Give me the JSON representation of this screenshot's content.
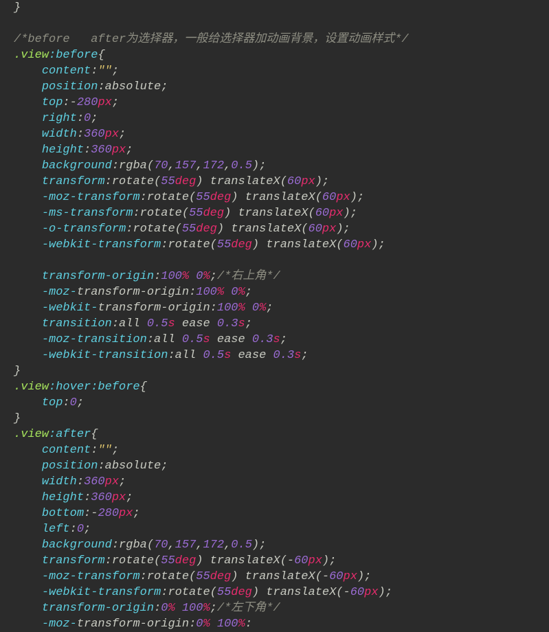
{
  "code": {
    "lines": [
      {
        "t": "punct",
        "s": "}"
      },
      {
        "t": "blank",
        "s": ""
      },
      {
        "t": "comment",
        "s": "/*before   after为选择器，一般给选择器加动画背景，设置动画样式*/"
      },
      {
        "t": "selector",
        "sel": ".view",
        "pseudo": ":before",
        "brace": "{"
      },
      {
        "t": "decl",
        "p": "content",
        "v": [
          {
            "t": "string",
            "s": "\"\""
          }
        ]
      },
      {
        "t": "decl",
        "p": "position",
        "v": [
          {
            "t": "value",
            "s": "absolute"
          }
        ]
      },
      {
        "t": "decl",
        "p": "top",
        "v": [
          {
            "t": "value",
            "s": "-"
          },
          {
            "t": "num",
            "s": "280"
          },
          {
            "t": "unit",
            "s": "px"
          }
        ]
      },
      {
        "t": "decl",
        "p": "right",
        "v": [
          {
            "t": "num",
            "s": "0"
          }
        ]
      },
      {
        "t": "decl",
        "p": "width",
        "v": [
          {
            "t": "num",
            "s": "360"
          },
          {
            "t": "unit",
            "s": "px"
          }
        ]
      },
      {
        "t": "decl",
        "p": "height",
        "v": [
          {
            "t": "num",
            "s": "360"
          },
          {
            "t": "unit",
            "s": "px"
          }
        ]
      },
      {
        "t": "decl",
        "p": "background",
        "v": [
          {
            "t": "func",
            "s": "rgba("
          },
          {
            "t": "num",
            "s": "70"
          },
          {
            "t": "punct",
            "s": ","
          },
          {
            "t": "num",
            "s": "157"
          },
          {
            "t": "punct",
            "s": ","
          },
          {
            "t": "num",
            "s": "172"
          },
          {
            "t": "punct",
            "s": ","
          },
          {
            "t": "num",
            "s": "0.5"
          },
          {
            "t": "func",
            "s": ")"
          }
        ]
      },
      {
        "t": "decl",
        "p": "transform",
        "v": [
          {
            "t": "func",
            "s": "rotate("
          },
          {
            "t": "num",
            "s": "55"
          },
          {
            "t": "unit",
            "s": "deg"
          },
          {
            "t": "func",
            "s": ") translateX("
          },
          {
            "t": "num",
            "s": "60"
          },
          {
            "t": "unit",
            "s": "px"
          },
          {
            "t": "func",
            "s": ")"
          }
        ]
      },
      {
        "t": "decl",
        "p": "-moz-transform",
        "v": [
          {
            "t": "func",
            "s": "rotate("
          },
          {
            "t": "num",
            "s": "55"
          },
          {
            "t": "unit",
            "s": "deg"
          },
          {
            "t": "func",
            "s": ") translateX("
          },
          {
            "t": "num",
            "s": "60"
          },
          {
            "t": "unit",
            "s": "px"
          },
          {
            "t": "func",
            "s": ")"
          }
        ]
      },
      {
        "t": "decl",
        "p": "-ms-transform",
        "v": [
          {
            "t": "func",
            "s": "rotate("
          },
          {
            "t": "num",
            "s": "55"
          },
          {
            "t": "unit",
            "s": "deg"
          },
          {
            "t": "func",
            "s": ") translateX("
          },
          {
            "t": "num",
            "s": "60"
          },
          {
            "t": "unit",
            "s": "px"
          },
          {
            "t": "func",
            "s": ")"
          }
        ]
      },
      {
        "t": "decl",
        "p": "-o-transform",
        "v": [
          {
            "t": "func",
            "s": "rotate("
          },
          {
            "t": "num",
            "s": "55"
          },
          {
            "t": "unit",
            "s": "deg"
          },
          {
            "t": "func",
            "s": ") translateX("
          },
          {
            "t": "num",
            "s": "60"
          },
          {
            "t": "unit",
            "s": "px"
          },
          {
            "t": "func",
            "s": ")"
          }
        ]
      },
      {
        "t": "decl",
        "p": "-webkit-transform",
        "v": [
          {
            "t": "func",
            "s": "rotate("
          },
          {
            "t": "num",
            "s": "55"
          },
          {
            "t": "unit",
            "s": "deg"
          },
          {
            "t": "func",
            "s": ") translateX("
          },
          {
            "t": "num",
            "s": "60"
          },
          {
            "t": "unit",
            "s": "px"
          },
          {
            "t": "func",
            "s": ")"
          }
        ]
      },
      {
        "t": "blank",
        "s": ""
      },
      {
        "t": "decl",
        "p": "transform-origin",
        "v": [
          {
            "t": "num",
            "s": "100"
          },
          {
            "t": "pct",
            "s": "%"
          },
          {
            "t": "value",
            "s": " "
          },
          {
            "t": "num",
            "s": "0"
          },
          {
            "t": "pct",
            "s": "%"
          }
        ],
        "trailcomment": "/*右上角*/"
      },
      {
        "t": "decl",
        "p2": [
          "-moz-",
          "transform-origin"
        ],
        "v": [
          {
            "t": "num",
            "s": "100"
          },
          {
            "t": "pct",
            "s": "%"
          },
          {
            "t": "value",
            "s": " "
          },
          {
            "t": "num",
            "s": "0"
          },
          {
            "t": "pct",
            "s": "%"
          }
        ]
      },
      {
        "t": "decl",
        "p2": [
          "-webkit-",
          "transform-origin"
        ],
        "v": [
          {
            "t": "num",
            "s": "100"
          },
          {
            "t": "pct",
            "s": "%"
          },
          {
            "t": "value",
            "s": " "
          },
          {
            "t": "num",
            "s": "0"
          },
          {
            "t": "pct",
            "s": "%"
          }
        ]
      },
      {
        "t": "decl",
        "p": "transition",
        "v": [
          {
            "t": "value",
            "s": "all "
          },
          {
            "t": "num",
            "s": "0.5"
          },
          {
            "t": "unit",
            "s": "s"
          },
          {
            "t": "value",
            "s": " ease "
          },
          {
            "t": "num",
            "s": "0.3"
          },
          {
            "t": "unit",
            "s": "s"
          }
        ]
      },
      {
        "t": "decl",
        "p": "-moz-transition",
        "v": [
          {
            "t": "value",
            "s": "all "
          },
          {
            "t": "num",
            "s": "0.5"
          },
          {
            "t": "unit",
            "s": "s"
          },
          {
            "t": "value",
            "s": " ease "
          },
          {
            "t": "num",
            "s": "0.3"
          },
          {
            "t": "unit",
            "s": "s"
          }
        ]
      },
      {
        "t": "decl",
        "p": "-webkit-transition",
        "v": [
          {
            "t": "value",
            "s": "all "
          },
          {
            "t": "num",
            "s": "0.5"
          },
          {
            "t": "unit",
            "s": "s"
          },
          {
            "t": "value",
            "s": " ease "
          },
          {
            "t": "num",
            "s": "0.3"
          },
          {
            "t": "unit",
            "s": "s"
          }
        ]
      },
      {
        "t": "punct",
        "s": "}"
      },
      {
        "t": "selector",
        "sel": ".view",
        "pseudo": ":hover:before",
        "brace": "{"
      },
      {
        "t": "decl",
        "p": "top",
        "v": [
          {
            "t": "num",
            "s": "0"
          }
        ]
      },
      {
        "t": "punct",
        "s": "}"
      },
      {
        "t": "selector",
        "sel": ".view",
        "pseudo": ":after",
        "brace": "{"
      },
      {
        "t": "decl",
        "p": "content",
        "v": [
          {
            "t": "string",
            "s": "\"\""
          }
        ]
      },
      {
        "t": "decl",
        "p": "position",
        "v": [
          {
            "t": "value",
            "s": "absolute"
          }
        ]
      },
      {
        "t": "decl",
        "p": "width",
        "v": [
          {
            "t": "num",
            "s": "360"
          },
          {
            "t": "unit",
            "s": "px"
          }
        ]
      },
      {
        "t": "decl",
        "p": "height",
        "v": [
          {
            "t": "num",
            "s": "360"
          },
          {
            "t": "unit",
            "s": "px"
          }
        ]
      },
      {
        "t": "decl",
        "p": "bottom",
        "v": [
          {
            "t": "value",
            "s": "-"
          },
          {
            "t": "num",
            "s": "280"
          },
          {
            "t": "unit",
            "s": "px"
          }
        ]
      },
      {
        "t": "decl",
        "p": "left",
        "v": [
          {
            "t": "num",
            "s": "0"
          }
        ]
      },
      {
        "t": "decl",
        "p": "background",
        "v": [
          {
            "t": "func",
            "s": "rgba("
          },
          {
            "t": "num",
            "s": "70"
          },
          {
            "t": "punct",
            "s": ","
          },
          {
            "t": "num",
            "s": "157"
          },
          {
            "t": "punct",
            "s": ","
          },
          {
            "t": "num",
            "s": "172"
          },
          {
            "t": "punct",
            "s": ","
          },
          {
            "t": "num",
            "s": "0.5"
          },
          {
            "t": "func",
            "s": ")"
          }
        ]
      },
      {
        "t": "decl",
        "p": "transform",
        "v": [
          {
            "t": "func",
            "s": "rotate("
          },
          {
            "t": "num",
            "s": "55"
          },
          {
            "t": "unit",
            "s": "deg"
          },
          {
            "t": "func",
            "s": ") translateX(-"
          },
          {
            "t": "num",
            "s": "60"
          },
          {
            "t": "unit",
            "s": "px"
          },
          {
            "t": "func",
            "s": ")"
          }
        ]
      },
      {
        "t": "decl",
        "p": "-moz-transform",
        "v": [
          {
            "t": "func",
            "s": "rotate("
          },
          {
            "t": "num",
            "s": "55"
          },
          {
            "t": "unit",
            "s": "deg"
          },
          {
            "t": "func",
            "s": ") translateX(-"
          },
          {
            "t": "num",
            "s": "60"
          },
          {
            "t": "unit",
            "s": "px"
          },
          {
            "t": "func",
            "s": ")"
          }
        ]
      },
      {
        "t": "decl",
        "p": "-webkit-transform",
        "v": [
          {
            "t": "func",
            "s": "rotate("
          },
          {
            "t": "num",
            "s": "55"
          },
          {
            "t": "unit",
            "s": "deg"
          },
          {
            "t": "func",
            "s": ") translateX(-"
          },
          {
            "t": "num",
            "s": "60"
          },
          {
            "t": "unit",
            "s": "px"
          },
          {
            "t": "func",
            "s": ")"
          }
        ]
      },
      {
        "t": "decl",
        "p": "transform-origin",
        "v": [
          {
            "t": "num",
            "s": "0"
          },
          {
            "t": "pct",
            "s": "%"
          },
          {
            "t": "value",
            "s": " "
          },
          {
            "t": "num",
            "s": "100"
          },
          {
            "t": "pct",
            "s": "%"
          }
        ],
        "term": ";",
        "trailcomment": "/*左下角*/"
      },
      {
        "t": "decl",
        "p2": [
          "-moz-",
          "transform-origin"
        ],
        "v": [
          {
            "t": "num",
            "s": "0"
          },
          {
            "t": "pct",
            "s": "%"
          },
          {
            "t": "value",
            "s": " "
          },
          {
            "t": "num",
            "s": "100"
          },
          {
            "t": "pct",
            "s": "%"
          }
        ],
        "term": ":"
      }
    ]
  }
}
